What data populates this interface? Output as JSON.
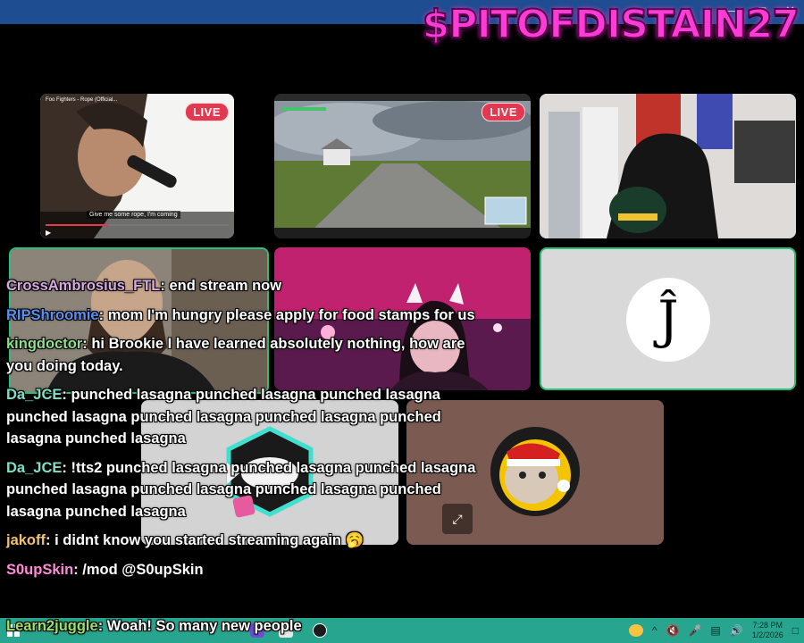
{
  "window": {
    "channel_title": "$PITOFDISTAIN27"
  },
  "tiles": {
    "music": {
      "video_title": "Foo Fighters - Rope (Official...",
      "lyric": "Give me some rope, I'm coming",
      "live": "LIVE"
    },
    "map": {
      "live": "LIVE"
    },
    "logo": {
      "letter": "Ĵ"
    }
  },
  "chat": [
    {
      "user": "CrossAmbrosius_FTL",
      "text": "end stream now",
      "color": "#d9a9e6"
    },
    {
      "user": "RIPShroomie",
      "text": "mom I'm hungry please apply for food stamps for us",
      "color": "#5b8ff0"
    },
    {
      "user": "kingdoctor",
      "text": "hi Brookie I have learned absolutely nothing, how are you doing today.",
      "color": "#8fe08a"
    },
    {
      "user": "Da_JCE",
      "text": "punched lasagna punched lasagna punched lasagna punched lasagna punched lasagna punched lasagna punched lasagna punched lasagna",
      "color": "#7fe0c8"
    },
    {
      "user": "Da_JCE",
      "text": "!tts2 punched lasagna punched lasagna punched lasagna punched lasagna punched lasagna punched lasagna punched lasagna punched lasagna",
      "color": "#7fe0c8"
    },
    {
      "user": "jakoff",
      "text": "i didnt know you started streaming again 🥱",
      "color": "#f2c36b"
    },
    {
      "user": "S0upSkin",
      "text": "/mod @S0upSkin",
      "color": "#ff8bd8"
    },
    {
      "user": "Learn2juggle",
      "text": "Woah! So many new people",
      "color": "#9be06a"
    }
  ],
  "taskbar": {
    "time": "7:28 PM",
    "date": "1/2/2026"
  },
  "colors": {
    "live_red": "#e3384f",
    "taskbar": "#28a58e",
    "tile_border_green": "#27c27a",
    "title_magenta": "#ff3bd7"
  }
}
